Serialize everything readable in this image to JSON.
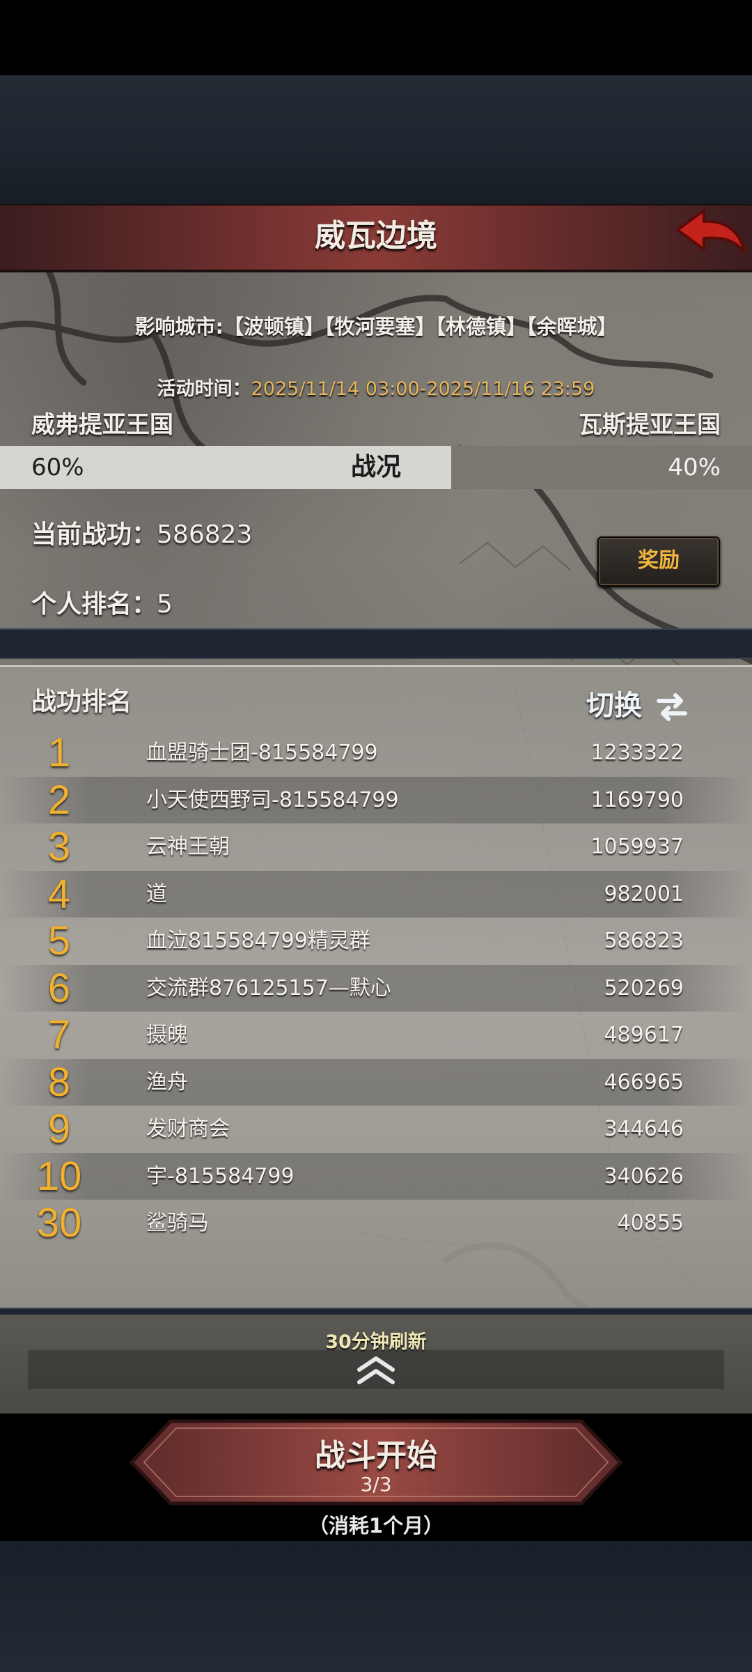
{
  "header": {
    "title": "威瓦边境",
    "back_icon": "red-back-arrow-icon"
  },
  "info": {
    "cities_label": "影响城市:",
    "cities": "【波顿镇】【牧河要塞】【林德镇】【余晖城】",
    "time_label": "活动时间：",
    "time_value": "2025/11/14 03:00-2025/11/16 23:59"
  },
  "war": {
    "left_kingdom": "威弗提亚王国",
    "right_kingdom": "瓦斯提亚王国",
    "left_pct_label": "60%",
    "right_pct_label": "40%",
    "left_fraction": 0.6,
    "center_label": "战况"
  },
  "personal": {
    "merit_label": "当前战功：",
    "merit_value": "586823",
    "rank_label": "个人排名：",
    "rank_value": "5",
    "reward_button": "奖励"
  },
  "ranking": {
    "title": "战功排名",
    "switch_label": "切换",
    "rows": [
      {
        "rank": "1",
        "name": "血盟骑士团-815584799",
        "score": "1233322"
      },
      {
        "rank": "2",
        "name": "小天使西野司-815584799",
        "score": "1169790"
      },
      {
        "rank": "3",
        "name": "云神王朝",
        "score": "1059937"
      },
      {
        "rank": "4",
        "name": "道",
        "score": "982001"
      },
      {
        "rank": "5",
        "name": "血泣815584799精灵群",
        "score": "586823"
      },
      {
        "rank": "6",
        "name": "交流群876125157—默心",
        "score": "520269"
      },
      {
        "rank": "7",
        "name": "摄魄",
        "score": "489617"
      },
      {
        "rank": "8",
        "name": "渔舟",
        "score": "466965"
      },
      {
        "rank": "9",
        "name": "发财商会",
        "score": "344646"
      },
      {
        "rank": "10",
        "name": "宇-815584799",
        "score": "340626"
      },
      {
        "rank": "30",
        "name": "鲨骑马",
        "score": "40855"
      }
    ],
    "refresh_note": "30分钟刷新"
  },
  "battle": {
    "label": "战斗开始",
    "count": "3/3",
    "consume": "（消耗1个月）"
  },
  "colors": {
    "title_bar": "#8a3b36",
    "rank_number": "#f0b030",
    "reward_text": "#f2b53e",
    "time_value": "#e9b75c"
  }
}
